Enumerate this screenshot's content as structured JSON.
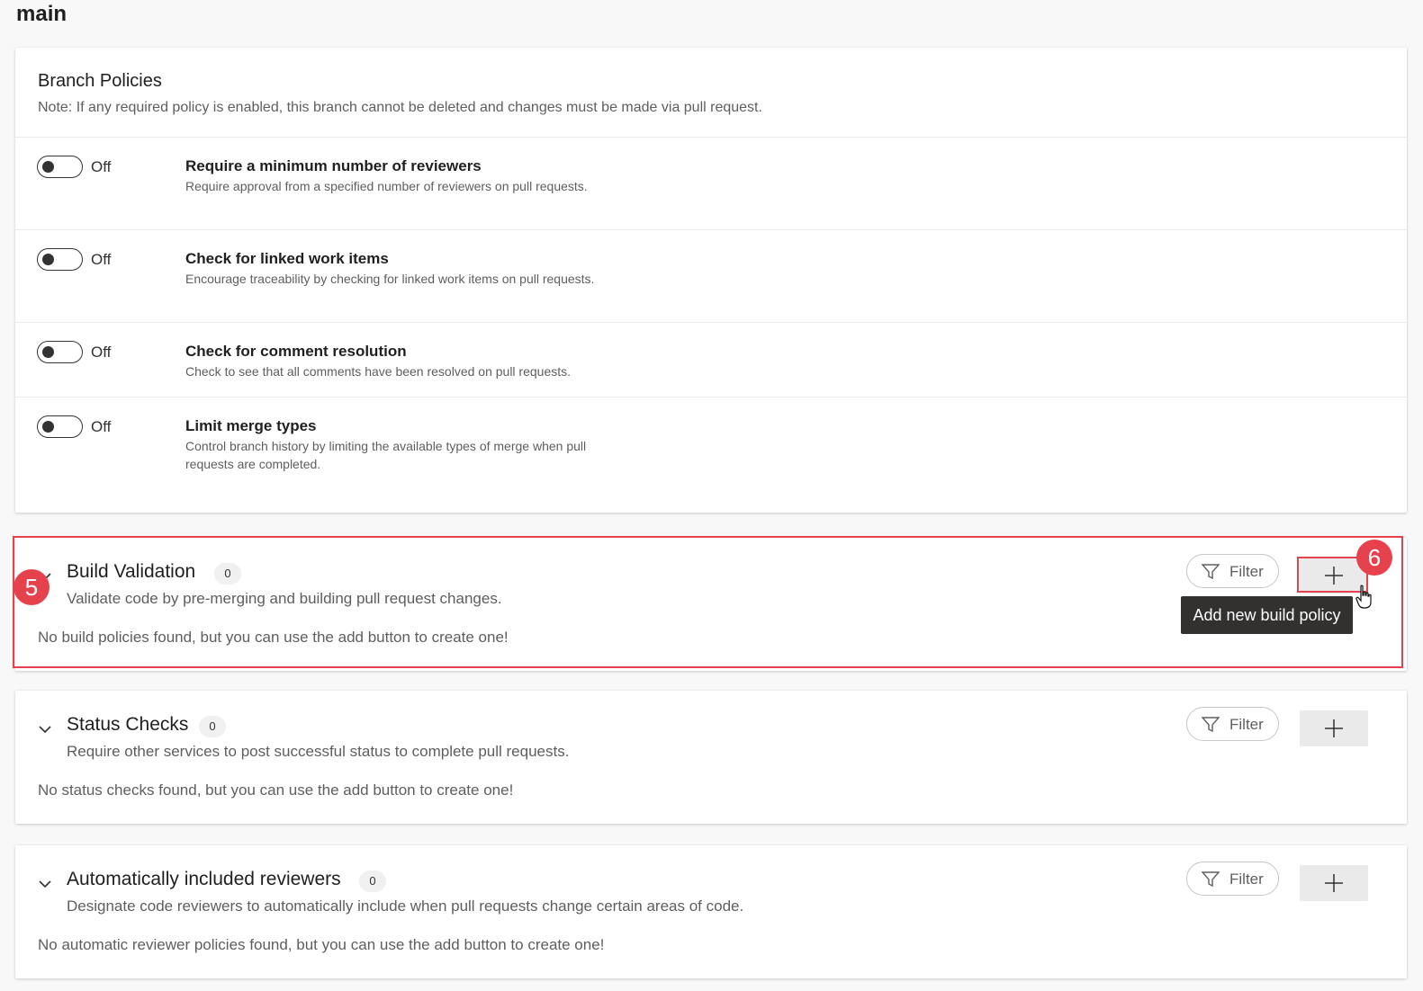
{
  "page": {
    "title": "main"
  },
  "branch_policies": {
    "title": "Branch Policies",
    "note": "Note: If any required policy is enabled, this branch cannot be deleted and changes must be made via pull request.",
    "items": [
      {
        "toggle": "Off",
        "title": "Require a minimum number of reviewers",
        "description": "Require approval from a specified number of reviewers on pull requests."
      },
      {
        "toggle": "Off",
        "title": "Check for linked work items",
        "description": "Encourage traceability by checking for linked work items on pull requests."
      },
      {
        "toggle": "Off",
        "title": "Check for comment resolution",
        "description": "Check to see that all comments have been resolved on pull requests."
      },
      {
        "toggle": "Off",
        "title": "Limit merge types",
        "description": "Control branch history by limiting the available types of merge when pull requests are completed."
      }
    ]
  },
  "sections": {
    "build": {
      "title": "Build Validation",
      "count": "0",
      "description": "Validate code by pre-merging and building pull request changes.",
      "empty": "No build policies found, but you can use the add button to create one!",
      "filter": "Filter"
    },
    "status": {
      "title": "Status Checks",
      "count": "0",
      "description": "Require other services to post successful status to complete pull requests.",
      "empty": "No status checks found, but you can use the add button to create one!",
      "filter": "Filter"
    },
    "reviewers": {
      "title": "Automatically included reviewers",
      "count": "0",
      "description": "Designate code reviewers to automatically include when pull requests change certain areas of code.",
      "empty": "No automatic reviewer policies found, but you can use the add button to create one!",
      "filter": "Filter"
    }
  },
  "tooltip": "Add new build policy",
  "annotations": {
    "step5": "5",
    "step6": "6",
    "color": "#e5424d"
  },
  "icons": {
    "chevron": "chevron-down-icon",
    "filter": "filter-icon",
    "add": "plus-icon",
    "cursor": "hand-pointer-icon"
  }
}
